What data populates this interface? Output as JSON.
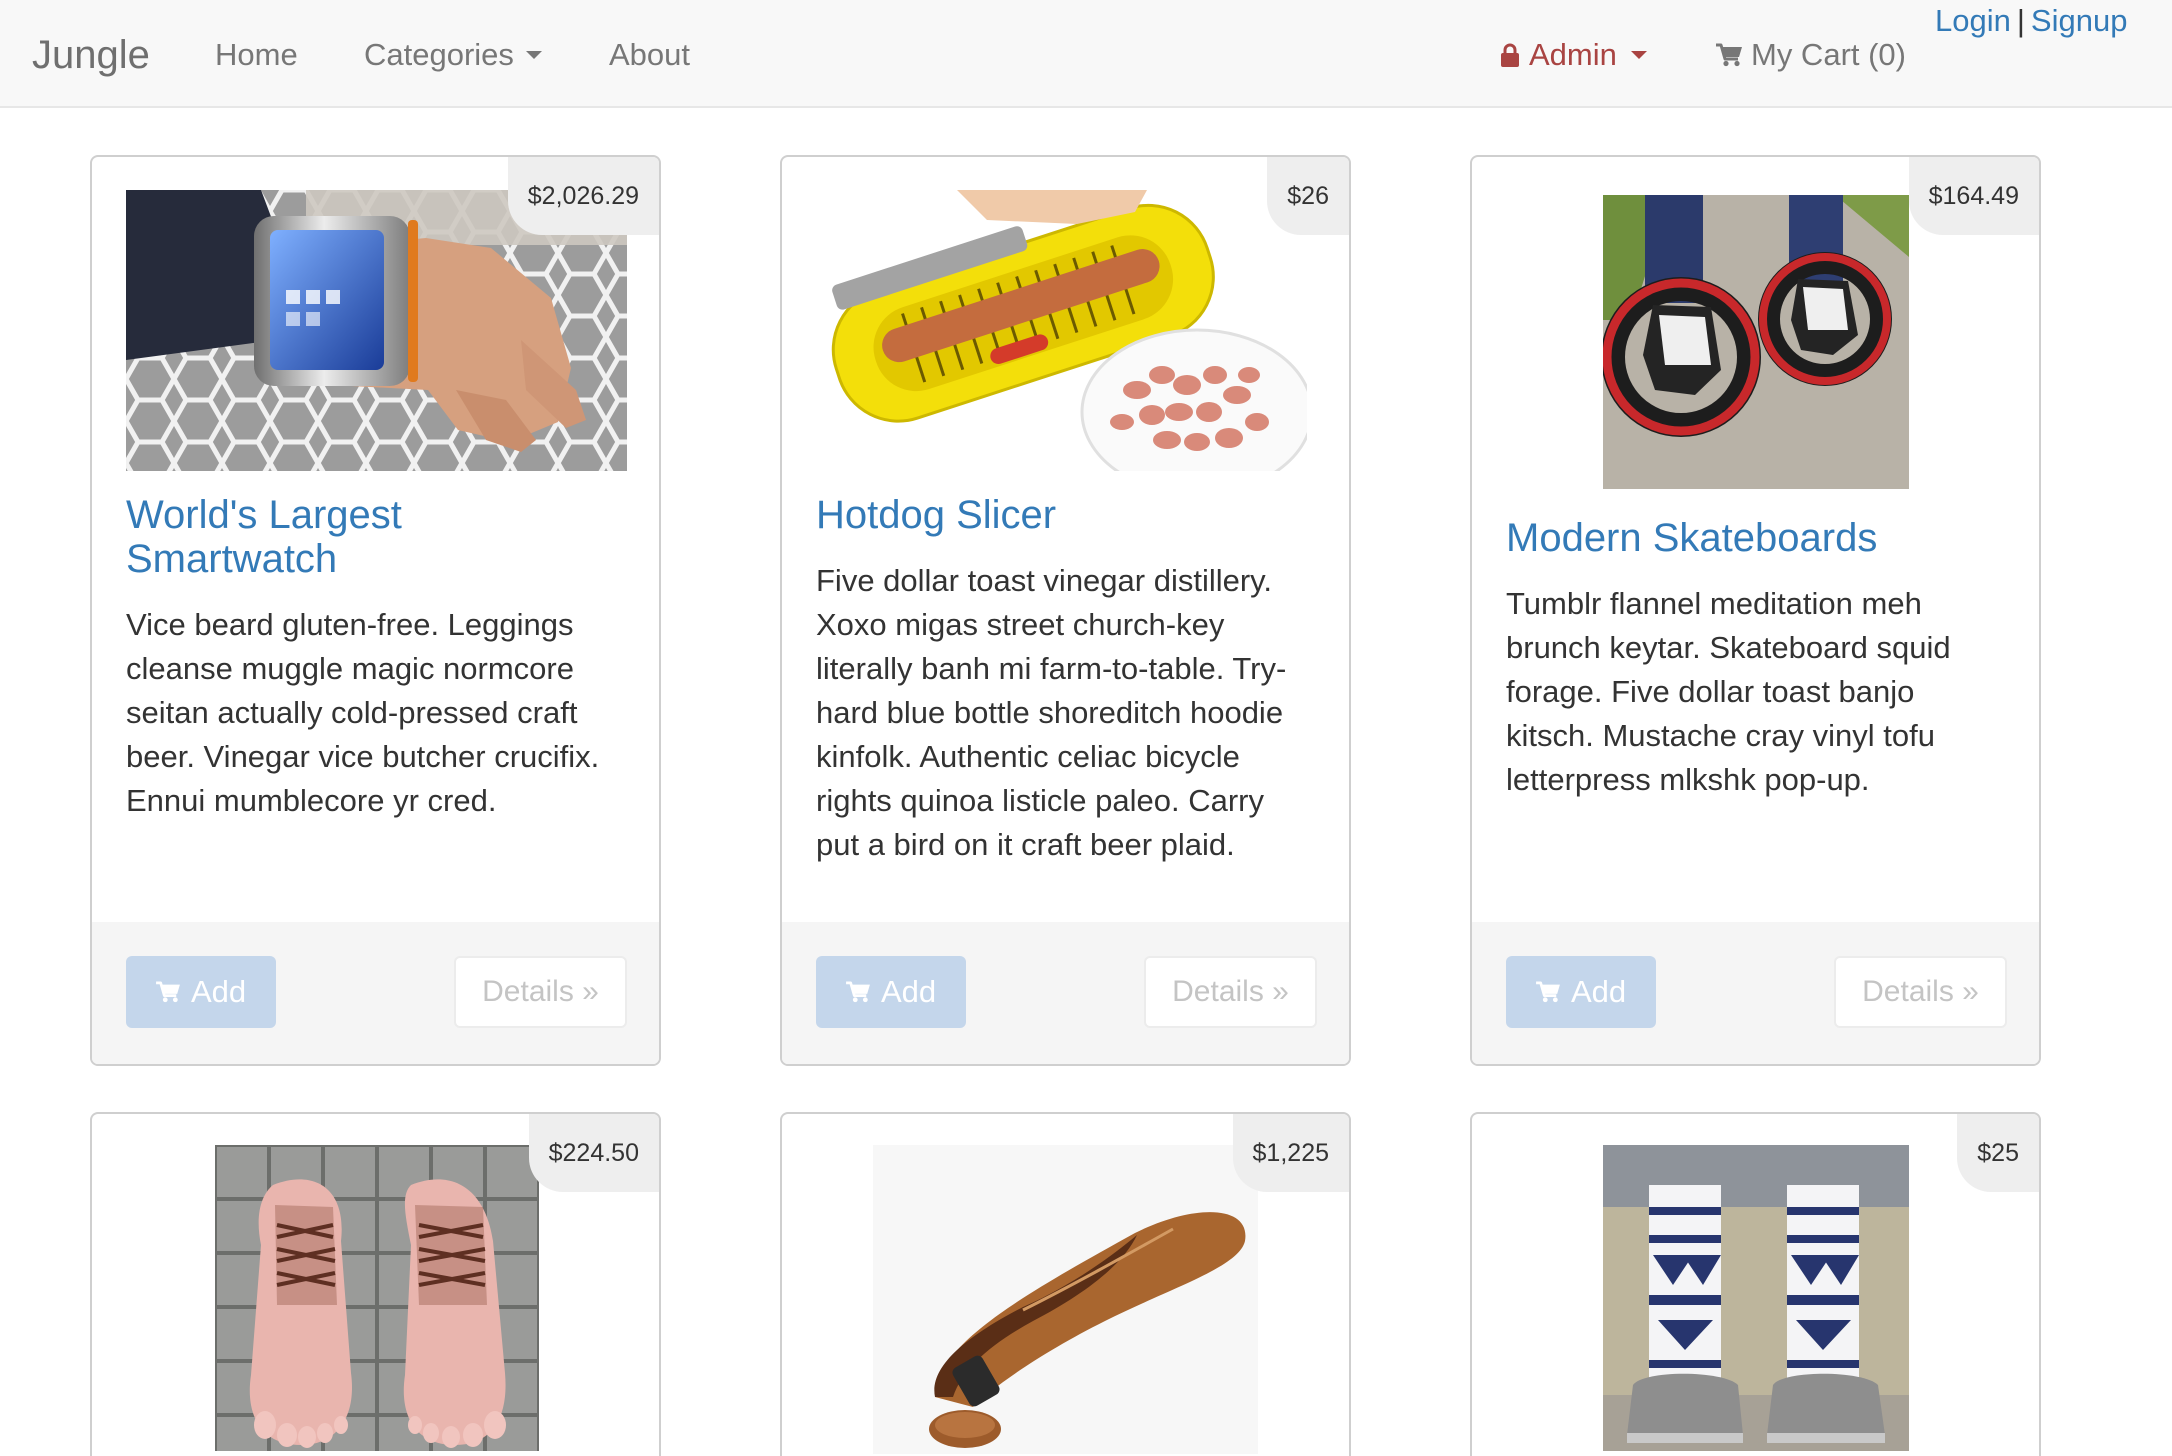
{
  "navbar": {
    "brand": "Jungle",
    "home": "Home",
    "categories": "Categories",
    "about": "About",
    "admin": "Admin",
    "cart": "My Cart (0)",
    "login": "Login",
    "separator": "|",
    "signup": "Signup"
  },
  "icons": {
    "admin": "lock-icon",
    "cart": "cart-icon",
    "dropdown": "caret-down-icon"
  },
  "colors": {
    "accent": "#337ab7",
    "admin": "#a94442",
    "navbar_bg": "#f8f8f8",
    "add_button": "#c4d6eb",
    "price_tag": "#eeeeee",
    "footer": "#f5f5f5"
  },
  "products": [
    {
      "price": "$2,026.29",
      "name": "World's Largest Smartwatch",
      "description": "Vice beard gluten-free. Leggings cleanse muggle magic normcore seitan actually cold-pressed craft beer. Vinegar vice butcher crucifix. Ennui mumblecore yr cred.",
      "add_label": "Add",
      "details_label": "Details »"
    },
    {
      "price": "$26",
      "name": "Hotdog Slicer",
      "description": "Five dollar toast vinegar distillery. Xoxo migas street church-key literally banh mi farm-to-table. Try-hard blue bottle shoreditch hoodie kinfolk. Authentic celiac bicycle rights quinoa listicle paleo. Carry put a bird on it craft beer plaid.",
      "add_label": "Add",
      "details_label": "Details »"
    },
    {
      "price": "$164.49",
      "name": "Modern Skateboards",
      "description": "Tumblr flannel meditation meh brunch keytar. Skateboard squid forage. Five dollar toast banjo kitsch. Mustache cray vinyl tofu letterpress mlkshk pop-up.",
      "add_label": "Add",
      "details_label": "Details »"
    },
    {
      "price": "$224.50"
    },
    {
      "price": "$1,225"
    },
    {
      "price": "$25"
    }
  ]
}
